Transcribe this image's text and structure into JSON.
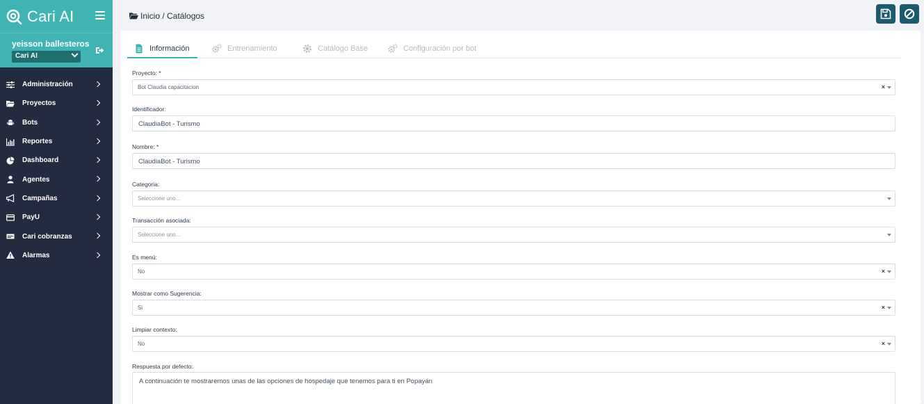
{
  "app": {
    "brand_name": "Cari AI",
    "accent_color": "#3fb4b2",
    "sidebar_color": "#232c3e"
  },
  "user": {
    "name": "yeisson ballesteros",
    "selected_project": "Cari AI"
  },
  "sidebar": {
    "items": [
      {
        "label": "Administración",
        "icon": "sliders-icon"
      },
      {
        "label": "Proyectos",
        "icon": "folder-open-icon"
      },
      {
        "label": "Bots",
        "icon": "android-icon"
      },
      {
        "label": "Reportes",
        "icon": "bar-chart-icon"
      },
      {
        "label": "Dashboard",
        "icon": "pie-chart-icon"
      },
      {
        "label": "Agentes",
        "icon": "user-icon"
      },
      {
        "label": "Campañas",
        "icon": "bullhorn-icon"
      },
      {
        "label": "PayU",
        "icon": "credit-card-icon"
      },
      {
        "label": "Cari cobranzas",
        "icon": "money-icon"
      },
      {
        "label": "Alarmas",
        "icon": "warning-icon"
      }
    ]
  },
  "header": {
    "breadcrumb": "Inicio / Catálogos"
  },
  "tabs": [
    {
      "label": "Información",
      "active": true
    },
    {
      "label": "Entrenamiento",
      "active": false
    },
    {
      "label": "Catálogo Base",
      "active": false
    },
    {
      "label": "Configuración por bot",
      "active": false
    }
  ],
  "form": {
    "proyecto": {
      "label": "Proyecto: *",
      "value": "Bot Claudia capacitacion"
    },
    "identificador": {
      "label": "Identificador:",
      "value": "ClaudiaBot - Turismo"
    },
    "nombre": {
      "label": "Nombre: *",
      "value": "ClaudiaBot - Turismo"
    },
    "categoria": {
      "label": "Categoria:",
      "placeholder": "Seleccione uno..."
    },
    "transaccion": {
      "label": "Transacción asociada:",
      "placeholder": "Seleccione uno..."
    },
    "es_menu": {
      "label": "Es menú:",
      "value": "No"
    },
    "sugerencia": {
      "label": "Mostrar como Sugerencia:",
      "value": "Si"
    },
    "limpiar": {
      "label": "Limpiar contexto:",
      "value": "No"
    },
    "respuesta": {
      "label": "Respuesta por defecto:",
      "value": "A continuación  te mostraremos unas de las opciones de hospedaje que tenemos para ti  en Popayán"
    }
  }
}
